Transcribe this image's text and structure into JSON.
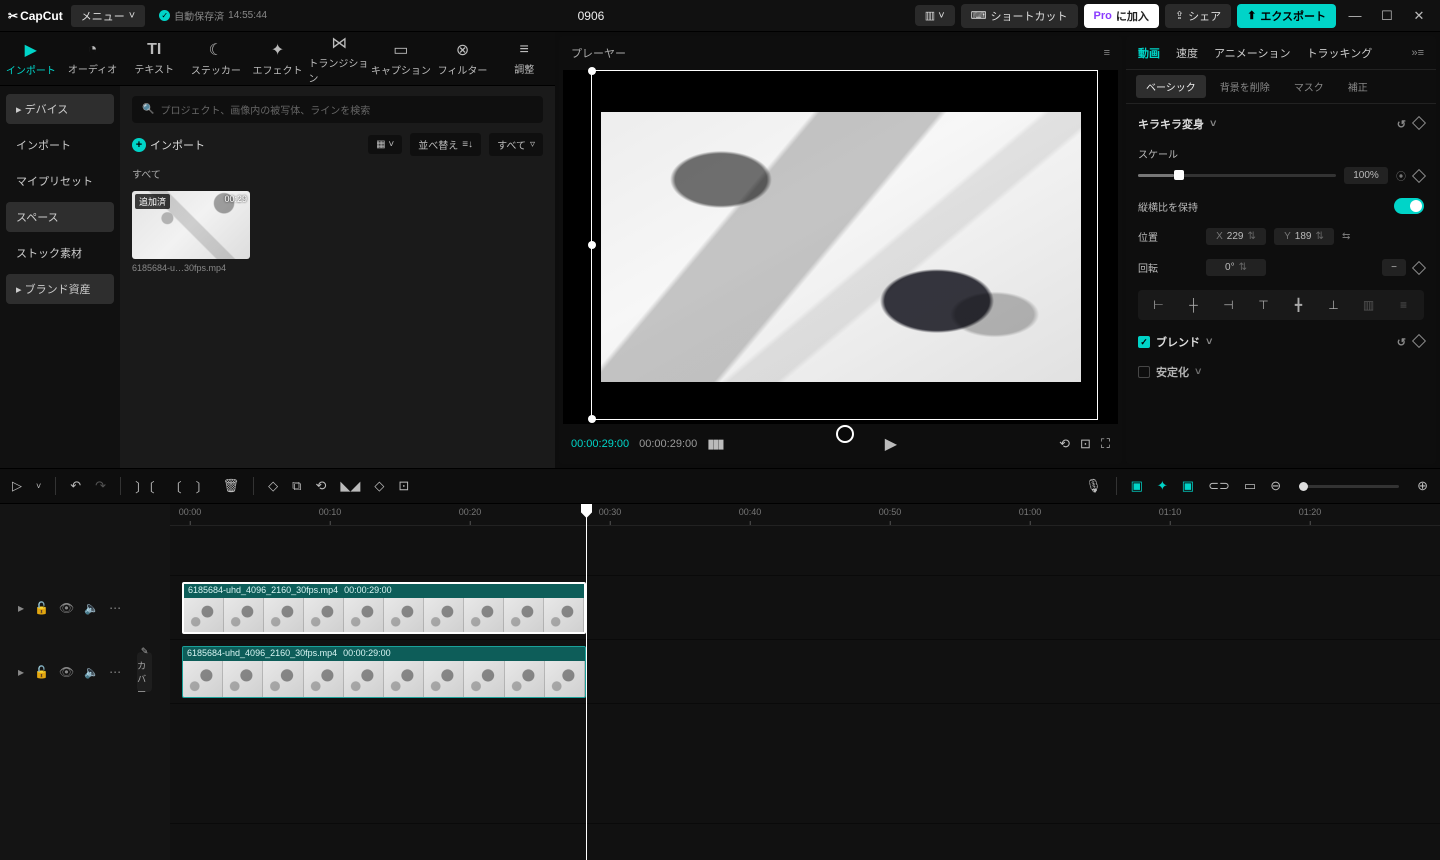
{
  "titlebar": {
    "app": "CapCut",
    "menu": "メニュー",
    "autosave_label": "自動保存済",
    "autosave_time": "14:55:44",
    "project": "0906",
    "shortcut": "ショートカット",
    "pro_prefix": "Pro",
    "pro_suffix": "に加入",
    "share": "シェア",
    "export": "エクスポート"
  },
  "toptabs": {
    "import": "インポート",
    "audio": "オーディオ",
    "text": "テキスト",
    "sticker": "ステッカー",
    "effect": "エフェクト",
    "transition": "トランジション",
    "caption": "キャプション",
    "filter": "フィルター",
    "adjust": "調整"
  },
  "sidebar": {
    "device": "デバイス",
    "import": "インポート",
    "mypreset": "マイプリセット",
    "space": "スペース",
    "stock": "ストック素材",
    "brand": "ブランド資産"
  },
  "media": {
    "search_placeholder": "プロジェクト、画像内の被写体、ラインを検索",
    "import_btn": "インポート",
    "sort": "並べ替え",
    "all_filter": "すべて",
    "section_all": "すべて",
    "thumb_tag": "追加済",
    "thumb_dur": "00:29",
    "thumb_name": "6185684-u…30fps.mp4"
  },
  "player": {
    "title": "プレーヤー",
    "current": "00:00:29:00",
    "total": "00:00:29:00"
  },
  "inspector": {
    "tabs": {
      "video": "動画",
      "speed": "速度",
      "anim": "アニメーション",
      "track": "トラッキング"
    },
    "subtabs": {
      "basic": "ベーシック",
      "removebg": "背景を削除",
      "mask": "マスク",
      "correct": "補正"
    },
    "kirakira": "キラキラ変身",
    "scale_label": "スケール",
    "scale_value": "100%",
    "keep_ratio": "縦横比を保持",
    "position": "位置",
    "pos_x_label": "X",
    "pos_x": "229",
    "pos_y_label": "Y",
    "pos_y": "189",
    "rotation": "回転",
    "rotation_val": "0°",
    "blend": "ブレンド",
    "stabilize": "安定化"
  },
  "timeline": {
    "ticks": [
      "00:00",
      "00:10",
      "00:20",
      "00:30",
      "00:40",
      "00:50",
      "01:00",
      "01:10",
      "01:20"
    ],
    "clip_name": "6185684-uhd_4096_2160_30fps.mp4",
    "clip_dur": "00:00:29:00",
    "cover": "カバー"
  }
}
